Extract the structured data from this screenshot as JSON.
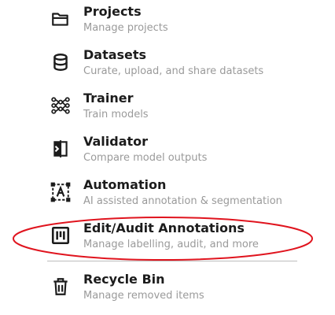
{
  "menu": {
    "items": [
      {
        "title": "Projects",
        "subtitle": "Manage projects",
        "icon": "folder-icon"
      },
      {
        "title": "Datasets",
        "subtitle": "Curate, upload, and share datasets",
        "icon": "database-icon"
      },
      {
        "title": "Trainer",
        "subtitle": "Train models",
        "icon": "neural-network-icon"
      },
      {
        "title": "Validator",
        "subtitle": "Compare model outputs",
        "icon": "compare-icon"
      },
      {
        "title": "Automation",
        "subtitle": "AI assisted annotation & segmentation",
        "icon": "auto-annotate-icon"
      },
      {
        "title": "Edit/Audit Annotations",
        "subtitle": "Manage labelling, audit, and more",
        "icon": "annotation-board-icon"
      }
    ],
    "footer_item": {
      "title": "Recycle Bin",
      "subtitle": "Manage removed items",
      "icon": "trash-icon"
    }
  },
  "highlight_color": "#e0141e",
  "text_color": "#1c1c1c",
  "subtext_color": "#9a9a9a"
}
